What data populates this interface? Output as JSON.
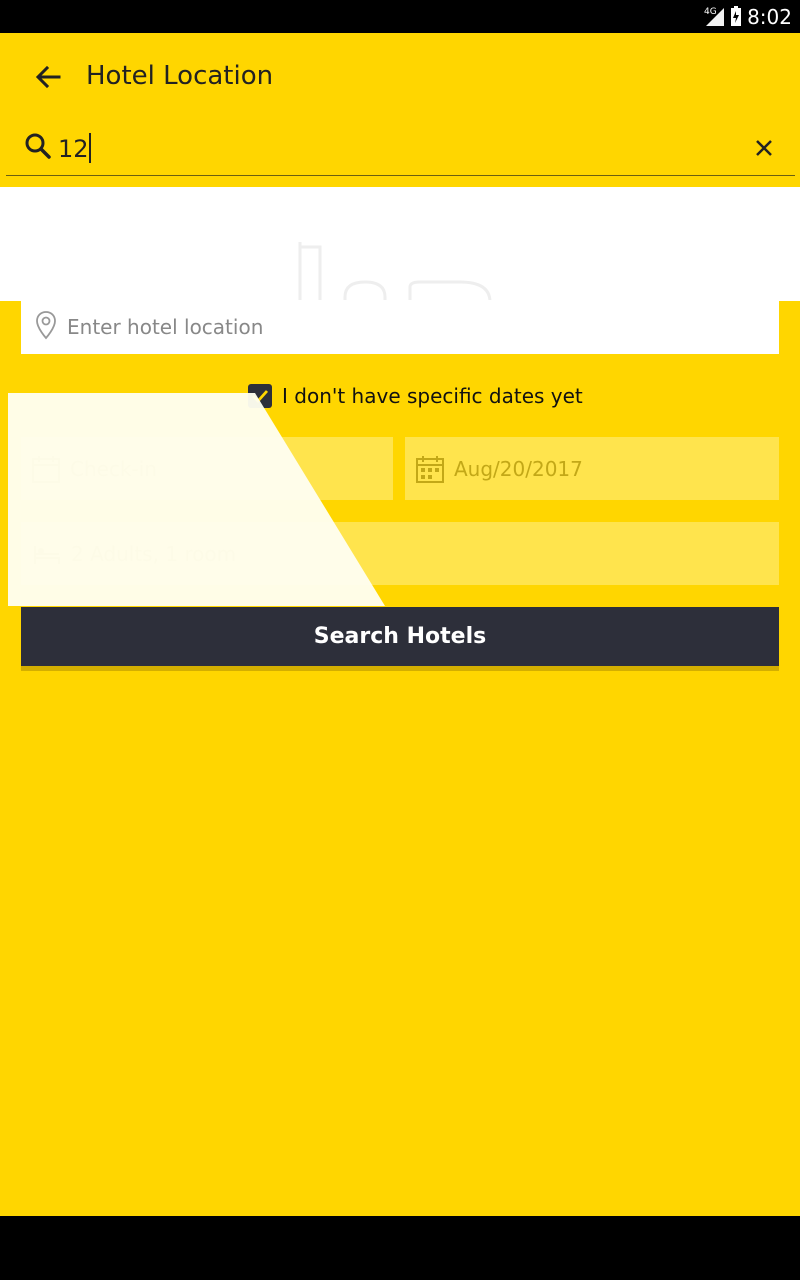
{
  "status_bar": {
    "network": "4G",
    "time": "8:02"
  },
  "header": {
    "title": "Hotel Location"
  },
  "search": {
    "value": "12"
  },
  "location": {
    "placeholder": "Enter hotel location"
  },
  "dates": {
    "no_dates_label": "I don't have specific dates yet",
    "no_dates_checked": true,
    "checkin_label": "Check-in",
    "checkout_value": "Aug/20/2017"
  },
  "guests": {
    "label": "2 Adults, 1 room"
  },
  "actions": {
    "search_label": "Search Hotels"
  },
  "colors": {
    "accent": "#FFD600",
    "button": "#2d2f3a",
    "field": "#FFE44D"
  }
}
